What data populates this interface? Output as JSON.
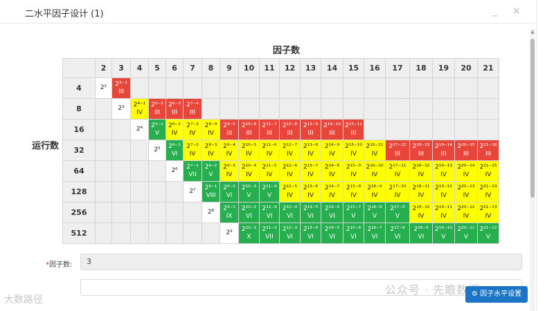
{
  "dialog": {
    "title": "二水平因子设计 (1)",
    "minimize_icon": "minimize-icon",
    "close_icon": "close-icon",
    "minimize_symbol": "_",
    "close_symbol": "×"
  },
  "grid": {
    "x_axis_title": "因子数",
    "y_axis_title": "运行数",
    "factor_headers": [
      "2",
      "3",
      "4",
      "5",
      "6",
      "7",
      "8",
      "9",
      "10",
      "11",
      "12",
      "13",
      "14",
      "15",
      "16",
      "17",
      "18",
      "19",
      "20",
      "21"
    ],
    "rows": [
      {
        "runs": "4",
        "cells": [
          {
            "t": "w",
            "a": "2²"
          },
          {
            "t": "r",
            "a": "2³⁻¹",
            "b": "III"
          },
          {
            "t": "e"
          },
          {
            "t": "e"
          },
          {
            "t": "e"
          },
          {
            "t": "e"
          },
          {
            "t": "e"
          },
          {
            "t": "e"
          },
          {
            "t": "e"
          },
          {
            "t": "e"
          },
          {
            "t": "e"
          },
          {
            "t": "e"
          },
          {
            "t": "e"
          },
          {
            "t": "e"
          },
          {
            "t": "e"
          },
          {
            "t": "e"
          },
          {
            "t": "e"
          },
          {
            "t": "e"
          },
          {
            "t": "e"
          },
          {
            "t": "e"
          }
        ]
      },
      {
        "runs": "8",
        "cells": [
          {
            "t": "e"
          },
          {
            "t": "w",
            "a": "2³"
          },
          {
            "t": "y",
            "a": "2⁴⁻¹",
            "b": "IV"
          },
          {
            "t": "r",
            "a": "2⁵⁻²",
            "b": "III"
          },
          {
            "t": "r",
            "a": "2⁶⁻³",
            "b": "III"
          },
          {
            "t": "r",
            "a": "2⁷⁻⁴",
            "b": "III"
          },
          {
            "t": "e"
          },
          {
            "t": "e"
          },
          {
            "t": "e"
          },
          {
            "t": "e"
          },
          {
            "t": "e"
          },
          {
            "t": "e"
          },
          {
            "t": "e"
          },
          {
            "t": "e"
          },
          {
            "t": "e"
          },
          {
            "t": "e"
          },
          {
            "t": "e"
          },
          {
            "t": "e"
          },
          {
            "t": "e"
          },
          {
            "t": "e"
          }
        ]
      },
      {
        "runs": "16",
        "cells": [
          {
            "t": "e"
          },
          {
            "t": "e"
          },
          {
            "t": "w",
            "a": "2⁴"
          },
          {
            "t": "g",
            "a": "2⁵⁻¹",
            "b": "V"
          },
          {
            "t": "y",
            "a": "2⁶⁻²",
            "b": "IV"
          },
          {
            "t": "y",
            "a": "2⁷⁻³",
            "b": "IV"
          },
          {
            "t": "y",
            "a": "2⁸⁻⁴",
            "b": "IV"
          },
          {
            "t": "r",
            "a": "2⁹⁻⁵",
            "b": "III"
          },
          {
            "t": "r",
            "a": "2¹⁰⁻⁶",
            "b": "III"
          },
          {
            "t": "r",
            "a": "2¹¹⁻⁷",
            "b": "III"
          },
          {
            "t": "r",
            "a": "2¹²⁻⁸",
            "b": "III"
          },
          {
            "t": "r",
            "a": "2¹³⁻⁹",
            "b": "III"
          },
          {
            "t": "r",
            "a": "2¹⁴⁻¹⁰",
            "b": "III"
          },
          {
            "t": "r",
            "a": "2¹⁵⁻¹¹",
            "b": "III"
          },
          {
            "t": "e"
          },
          {
            "t": "e"
          },
          {
            "t": "e"
          },
          {
            "t": "e"
          },
          {
            "t": "e"
          },
          {
            "t": "e"
          }
        ]
      },
      {
        "runs": "32",
        "cells": [
          {
            "t": "e"
          },
          {
            "t": "e"
          },
          {
            "t": "e"
          },
          {
            "t": "w",
            "a": "2⁵"
          },
          {
            "t": "g",
            "a": "2⁶⁻¹",
            "b": "VI"
          },
          {
            "t": "y",
            "a": "2⁷⁻²",
            "b": "IV"
          },
          {
            "t": "y",
            "a": "2⁸⁻³",
            "b": "IV"
          },
          {
            "t": "y",
            "a": "2⁹⁻⁴",
            "b": "IV"
          },
          {
            "t": "y",
            "a": "2¹⁰⁻⁵",
            "b": "IV"
          },
          {
            "t": "y",
            "a": "2¹¹⁻⁶",
            "b": "IV"
          },
          {
            "t": "y",
            "a": "2¹²⁻⁷",
            "b": "IV"
          },
          {
            "t": "y",
            "a": "2¹³⁻⁸",
            "b": "IV"
          },
          {
            "t": "y",
            "a": "2¹⁴⁻⁹",
            "b": "IV"
          },
          {
            "t": "y",
            "a": "2¹⁵⁻¹⁰",
            "b": "IV"
          },
          {
            "t": "y",
            "a": "2¹⁶⁻¹¹",
            "b": "IV"
          },
          {
            "t": "r",
            "a": "2¹⁷⁻¹²",
            "b": "III"
          },
          {
            "t": "r",
            "a": "2¹⁸⁻¹³",
            "b": "III"
          },
          {
            "t": "r",
            "a": "2¹⁹⁻¹⁴",
            "b": "III"
          },
          {
            "t": "r",
            "a": "2²⁰⁻¹⁵",
            "b": "III"
          },
          {
            "t": "r",
            "a": "2²¹⁻¹⁶",
            "b": "III"
          }
        ]
      },
      {
        "runs": "64",
        "cells": [
          {
            "t": "e"
          },
          {
            "t": "e"
          },
          {
            "t": "e"
          },
          {
            "t": "e"
          },
          {
            "t": "w",
            "a": "2⁶"
          },
          {
            "t": "g",
            "a": "2⁷⁻¹",
            "b": "VII"
          },
          {
            "t": "g",
            "a": "2⁸⁻²",
            "b": "V"
          },
          {
            "t": "y",
            "a": "2⁹⁻³",
            "b": "IV"
          },
          {
            "t": "y",
            "a": "2¹⁰⁻⁴",
            "b": "IV"
          },
          {
            "t": "y",
            "a": "2¹¹⁻⁵",
            "b": "IV"
          },
          {
            "t": "y",
            "a": "2¹²⁻⁶",
            "b": "IV"
          },
          {
            "t": "y",
            "a": "2¹³⁻⁷",
            "b": "IV"
          },
          {
            "t": "y",
            "a": "2¹⁴⁻⁸",
            "b": "IV"
          },
          {
            "t": "y",
            "a": "2¹⁵⁻⁹",
            "b": "IV"
          },
          {
            "t": "y",
            "a": "2¹⁶⁻¹⁰",
            "b": "IV"
          },
          {
            "t": "y",
            "a": "2¹⁷⁻¹¹",
            "b": "IV"
          },
          {
            "t": "y",
            "a": "2¹⁸⁻¹²",
            "b": "IV"
          },
          {
            "t": "y",
            "a": "2¹⁹⁻¹³",
            "b": "IV"
          },
          {
            "t": "y",
            "a": "2²⁰⁻¹⁴",
            "b": "IV"
          },
          {
            "t": "y",
            "a": "2²¹⁻¹⁵",
            "b": "IV"
          }
        ]
      },
      {
        "runs": "128",
        "cells": [
          {
            "t": "e"
          },
          {
            "t": "e"
          },
          {
            "t": "e"
          },
          {
            "t": "e"
          },
          {
            "t": "e"
          },
          {
            "t": "w",
            "a": "2⁷"
          },
          {
            "t": "g",
            "a": "2⁸⁻¹",
            "b": "VIII"
          },
          {
            "t": "g",
            "a": "2⁹⁻²",
            "b": "VI"
          },
          {
            "t": "g",
            "a": "2¹⁰⁻³",
            "b": "V"
          },
          {
            "t": "g",
            "a": "2¹¹⁻⁴",
            "b": "V"
          },
          {
            "t": "y",
            "a": "2¹²⁻⁵",
            "b": "IV"
          },
          {
            "t": "y",
            "a": "2¹³⁻⁶",
            "b": "IV"
          },
          {
            "t": "y",
            "a": "2¹⁴⁻⁷",
            "b": "IV"
          },
          {
            "t": "y",
            "a": "2¹⁵⁻⁸",
            "b": "IV"
          },
          {
            "t": "y",
            "a": "2¹⁶⁻⁹",
            "b": "IV"
          },
          {
            "t": "y",
            "a": "2¹⁷⁻¹⁰",
            "b": "IV"
          },
          {
            "t": "y",
            "a": "2¹⁸⁻¹¹",
            "b": "IV"
          },
          {
            "t": "y",
            "a": "2¹⁹⁻¹²",
            "b": "IV"
          },
          {
            "t": "y",
            "a": "2²⁰⁻¹³",
            "b": "IV"
          },
          {
            "t": "y",
            "a": "2²¹⁻¹⁴",
            "b": "IV"
          }
        ]
      },
      {
        "runs": "256",
        "cells": [
          {
            "t": "e"
          },
          {
            "t": "e"
          },
          {
            "t": "e"
          },
          {
            "t": "e"
          },
          {
            "t": "e"
          },
          {
            "t": "e"
          },
          {
            "t": "w",
            "a": "2⁸"
          },
          {
            "t": "g",
            "a": "2⁹⁻¹",
            "b": "IX"
          },
          {
            "t": "g",
            "a": "2¹⁰⁻²",
            "b": "VI"
          },
          {
            "t": "g",
            "a": "2¹¹⁻³",
            "b": "VI"
          },
          {
            "t": "g",
            "a": "2¹²⁻⁴",
            "b": "VI"
          },
          {
            "t": "g",
            "a": "2¹³⁻⁵",
            "b": "VI"
          },
          {
            "t": "g",
            "a": "2¹⁴⁻⁶",
            "b": "VI"
          },
          {
            "t": "g",
            "a": "2¹⁵⁻⁷",
            "b": "V"
          },
          {
            "t": "g",
            "a": "2¹⁶⁻⁸",
            "b": "V"
          },
          {
            "t": "g",
            "a": "2¹⁷⁻⁹",
            "b": "V"
          },
          {
            "t": "y",
            "a": "2¹⁸⁻¹⁰",
            "b": "IV"
          },
          {
            "t": "y",
            "a": "2¹⁹⁻¹¹",
            "b": "IV"
          },
          {
            "t": "y",
            "a": "2²⁰⁻¹²",
            "b": "IV"
          },
          {
            "t": "y",
            "a": "2²¹⁻¹³",
            "b": "IV"
          }
        ]
      },
      {
        "runs": "512",
        "cells": [
          {
            "t": "e"
          },
          {
            "t": "e"
          },
          {
            "t": "e"
          },
          {
            "t": "e"
          },
          {
            "t": "e"
          },
          {
            "t": "e"
          },
          {
            "t": "e"
          },
          {
            "t": "w",
            "a": "2⁹"
          },
          {
            "t": "g",
            "a": "2¹⁰⁻¹",
            "b": "X"
          },
          {
            "t": "g",
            "a": "2¹¹⁻²",
            "b": "VII"
          },
          {
            "t": "g",
            "a": "2¹²⁻³",
            "b": "VI"
          },
          {
            "t": "g",
            "a": "2¹³⁻⁴",
            "b": "VI"
          },
          {
            "t": "g",
            "a": "2¹⁴⁻⁵",
            "b": "VI"
          },
          {
            "t": "g",
            "a": "2¹⁵⁻⁶",
            "b": "VI"
          },
          {
            "t": "g",
            "a": "2¹⁶⁻⁷",
            "b": "VI"
          },
          {
            "t": "g",
            "a": "2¹⁷⁻⁸",
            "b": "VI"
          },
          {
            "t": "g",
            "a": "2¹⁸⁻⁹",
            "b": "VI"
          },
          {
            "t": "g",
            "a": "2¹⁹⁻¹⁰",
            "b": "V"
          },
          {
            "t": "g",
            "a": "2²⁰⁻¹¹",
            "b": "V"
          },
          {
            "t": "g",
            "a": "2²¹⁻¹²",
            "b": "V"
          }
        ]
      }
    ]
  },
  "form": {
    "factor_label": "因子数:",
    "required_mark": "*",
    "factor_value": "3"
  },
  "actions": {
    "settings_button_label": "因子水平设置",
    "settings_icon": "gear-icon",
    "settings_symbol": "⚙"
  },
  "watermarks": {
    "right": "公众号 · 先瞻数据",
    "left": "大数路径"
  },
  "colors": {
    "red": "#e8463a",
    "yellow": "#ffff00",
    "green": "#27ae4f",
    "button": "#1c74c4"
  }
}
